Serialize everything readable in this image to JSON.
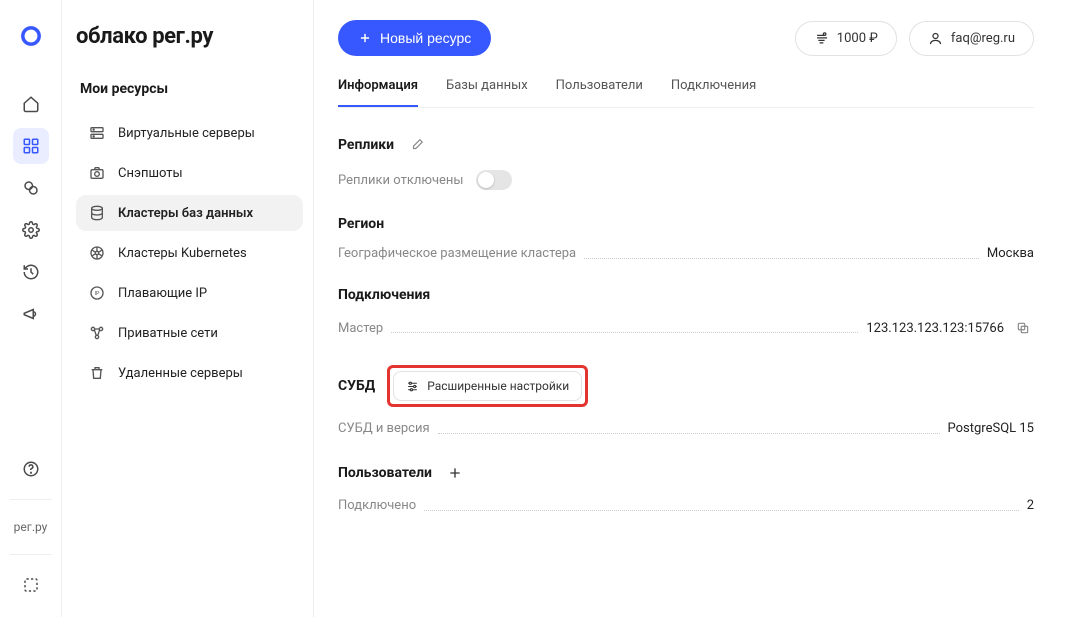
{
  "app_title": "облако рег.ру",
  "header": {
    "new_resource": "Новый ресурс",
    "balance": "1000 ₽",
    "account_email": "faq@reg.ru"
  },
  "sidebar": {
    "heading": "Мои ресурсы",
    "items": [
      {
        "label": "Виртуальные серверы",
        "icon": "server-icon"
      },
      {
        "label": "Снэпшоты",
        "icon": "camera-icon"
      },
      {
        "label": "Кластеры баз данных",
        "icon": "database-icon",
        "active": true
      },
      {
        "label": "Кластеры Kubernetes",
        "icon": "wheel-icon"
      },
      {
        "label": "Плавающие IP",
        "icon": "ip-icon"
      },
      {
        "label": "Приватные сети",
        "icon": "network-icon"
      },
      {
        "label": "Удаленные серверы",
        "icon": "trash-icon"
      }
    ]
  },
  "rail_footer_label": "рег.ру",
  "tabs": [
    {
      "label": "Информация",
      "active": true
    },
    {
      "label": "Базы данных"
    },
    {
      "label": "Пользователи"
    },
    {
      "label": "Подключения"
    }
  ],
  "sections": {
    "replicas": {
      "title": "Реплики",
      "status_text": "Реплики отключены",
      "enabled": false
    },
    "region": {
      "title": "Регион",
      "row_label": "Географическое размещение кластера",
      "value": "Москва"
    },
    "connections": {
      "title": "Подключения",
      "row_label": "Мастер",
      "value": "123.123.123.123:15766"
    },
    "dbms": {
      "title": "СУБД",
      "adv_button": "Расширенные настройки",
      "row_label": "СУБД и версия",
      "value": "PostgreSQL 15"
    },
    "users": {
      "title": "Пользователи",
      "row_label": "Подключено",
      "value": "2"
    }
  }
}
